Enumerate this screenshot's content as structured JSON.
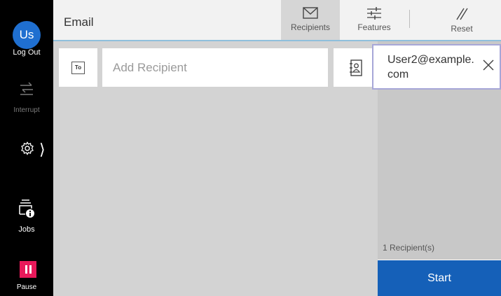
{
  "sidebar": {
    "avatar_initials": "Us",
    "logout_label": "Log Out",
    "interrupt_label": "Interrupt",
    "jobs_label": "Jobs",
    "pause_label": "Pause",
    "icons": [
      "interrupt-icon",
      "gear-icon",
      "chevron-right-icon",
      "jobs-icon",
      "pause-icon"
    ]
  },
  "header": {
    "title": "Email",
    "buttons": [
      {
        "label": "Recipients",
        "icon": "envelope-icon",
        "selected": true
      },
      {
        "label": "Features",
        "icon": "sliders-icon",
        "selected": false
      },
      {
        "label": "Reset",
        "icon": "reset-icon",
        "selected": false
      }
    ]
  },
  "main": {
    "to_badge": "To",
    "add_recipient_placeholder": "Add Recipient",
    "address_book_icon": "address-book-icon"
  },
  "recipients": {
    "items": [
      {
        "email": "User2@example.com",
        "remove_icon": "close-icon"
      }
    ],
    "count_label": "1 Recipient(s)"
  },
  "actions": {
    "start_label": "Start"
  },
  "colors": {
    "rail": "#000000",
    "avatar": "#1f6fd0",
    "pause": "#e8195a",
    "start": "#1560b8",
    "selected_tab": "#d6d6d6",
    "content_bg": "#d3d3d3",
    "panel_bg": "#c8c8c8"
  }
}
